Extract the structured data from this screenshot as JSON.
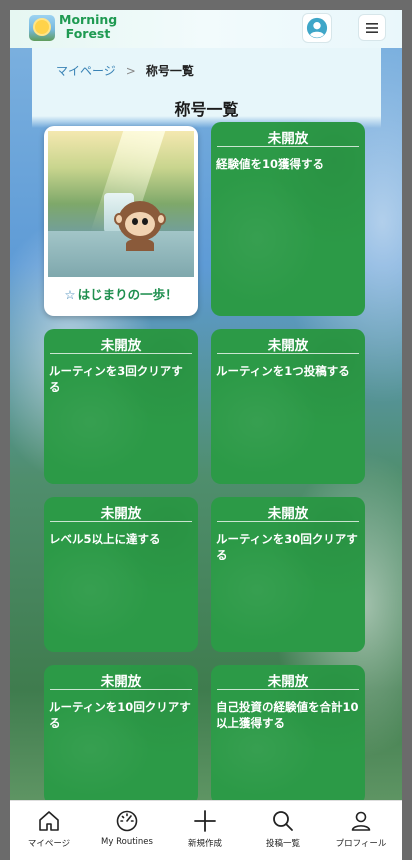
{
  "header": {
    "app_name": "Morning\nForest",
    "app_name_line1": "Morning",
    "app_name_line2": "Forest",
    "menu_icon": "menu-icon",
    "avatar_icon": "user-avatar-icon"
  },
  "breadcrumb": {
    "parent": "マイページ",
    "separator": ">",
    "current": "称号一覧"
  },
  "page": {
    "title": "称号一覧"
  },
  "titles": [
    {
      "status": "unlocked",
      "name": "はじまりの一歩！",
      "star": "☆"
    },
    {
      "status": "locked",
      "lock_label": "未開放",
      "condition": "経験値を10獲得する"
    },
    {
      "status": "locked",
      "lock_label": "未開放",
      "condition": "ルーティンを3回クリアする"
    },
    {
      "status": "locked",
      "lock_label": "未開放",
      "condition": "ルーティンを1つ投稿する"
    },
    {
      "status": "locked",
      "lock_label": "未開放",
      "condition": "レベル5以上に達する"
    },
    {
      "status": "locked",
      "lock_label": "未開放",
      "condition": "ルーティンを30回クリアする"
    },
    {
      "status": "locked",
      "lock_label": "未開放",
      "condition": "ルーティンを10回クリアする"
    },
    {
      "status": "locked",
      "lock_label": "未開放",
      "condition": "自己投資の経験値を合計10以上獲得する"
    }
  ],
  "nav": {
    "items": [
      {
        "label": "マイページ",
        "icon": "home-icon"
      },
      {
        "label": "My Routines",
        "icon": "speedometer-icon"
      },
      {
        "label": "新規作成",
        "icon": "plus-icon"
      },
      {
        "label": "投稿一覧",
        "icon": "search-icon"
      },
      {
        "label": "プロフィール",
        "icon": "person-icon"
      }
    ]
  },
  "colors": {
    "accent_green": "#2c9a47",
    "brand_green": "#1f9a52",
    "link_blue": "#3a83b5"
  }
}
